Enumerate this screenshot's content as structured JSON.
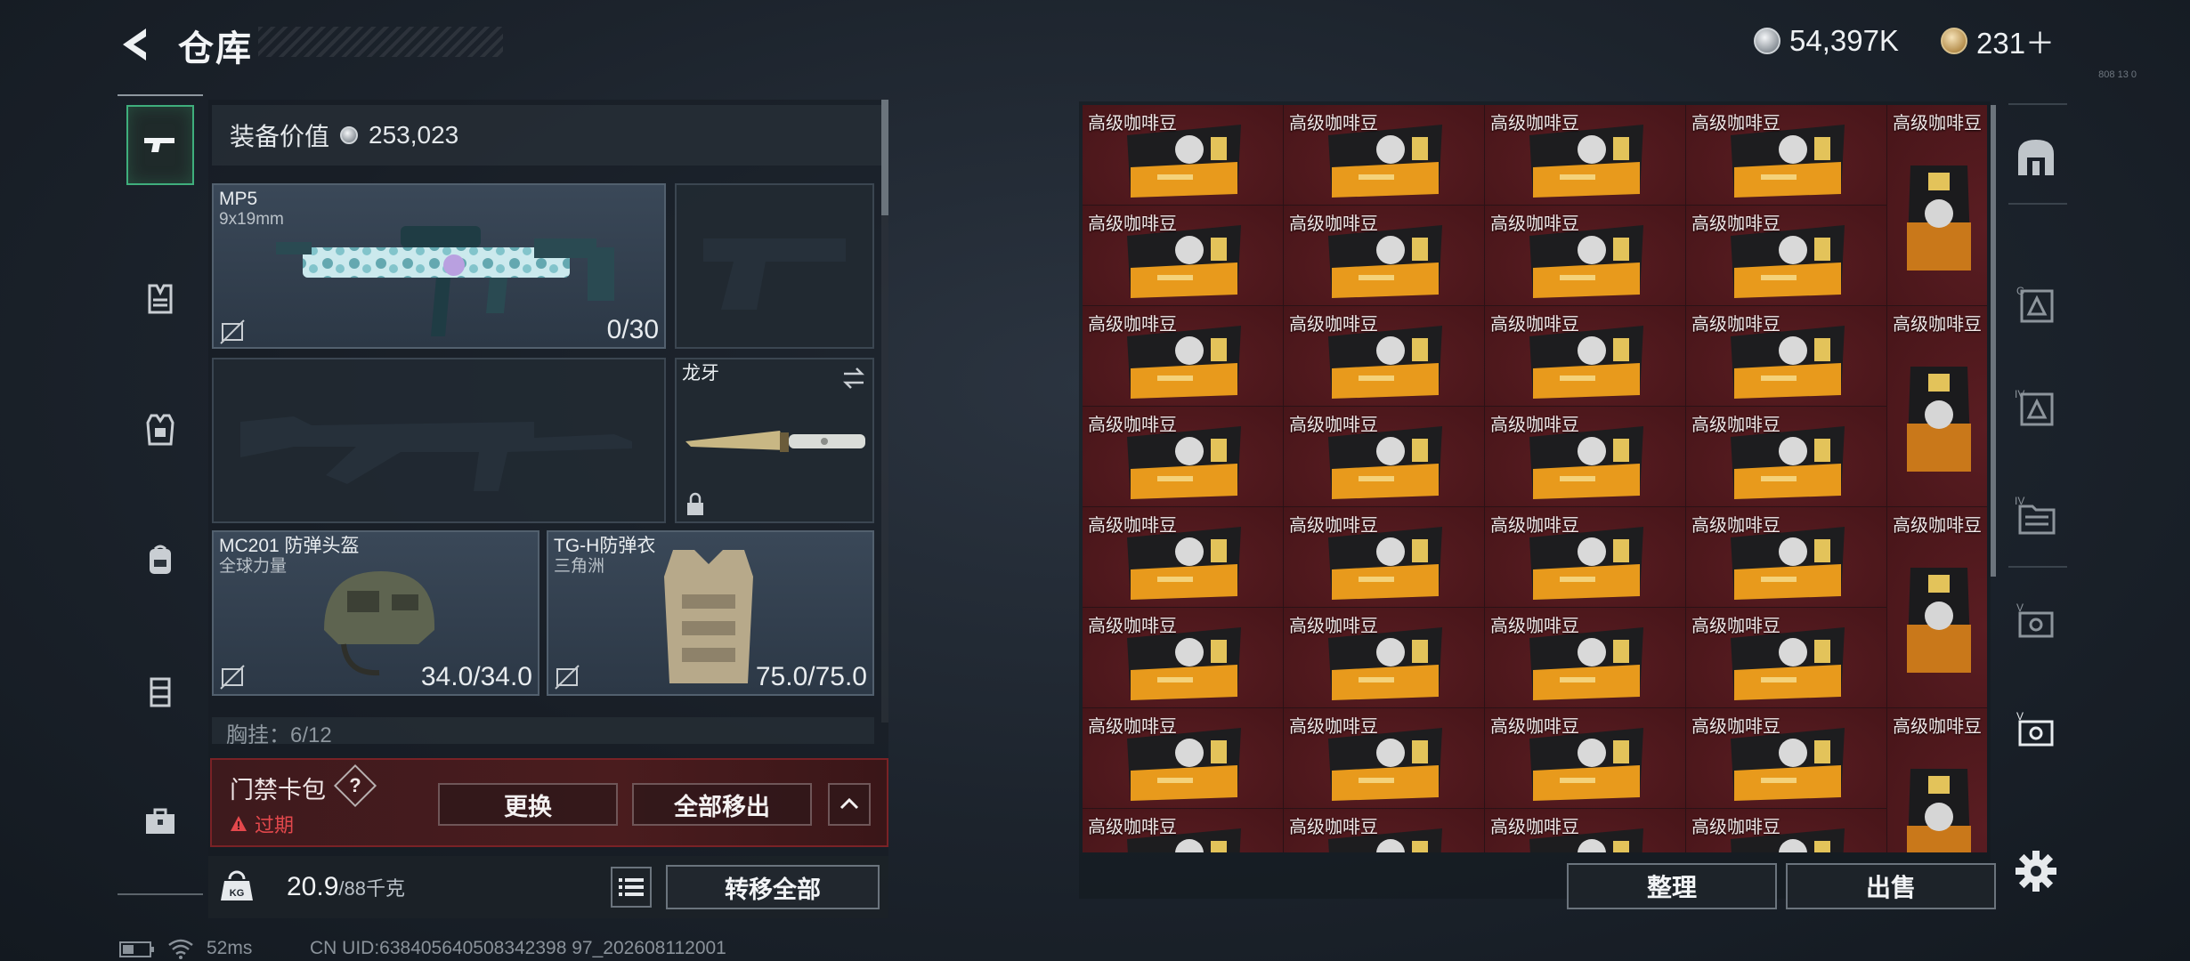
{
  "header": {
    "title": "仓库",
    "currency_silver": "54,397K",
    "currency_gold": "231＋",
    "version": "808 13 0"
  },
  "left_rail": {
    "items": [
      "pistol-icon",
      "backpack-frame-icon",
      "armor-vest-icon",
      "backpack-icon",
      "case-icon",
      "toolbox-icon"
    ]
  },
  "loadout": {
    "equip_value_label": "装备价值",
    "equip_value": "253,023",
    "primary": {
      "name": "MP5",
      "caliber": "9x19mm",
      "ammo": "0/30"
    },
    "knife": {
      "name": "龙牙"
    },
    "helmet": {
      "name": "MC201 防弹头盔",
      "brand": "全球力量",
      "durability": "34.0/34.0"
    },
    "armor": {
      "name": "TG-H防弹衣",
      "brand": "三角洲",
      "durability": "75.0/75.0"
    },
    "chest_row": "胸挂：6/12"
  },
  "card_bar": {
    "title": "门禁卡包",
    "help": "?",
    "status": "过期",
    "replace_label": "更换",
    "remove_all_label": "全部移出"
  },
  "weight": {
    "current": "20.9",
    "max": "/88千克",
    "transfer_all_label": "转移全部"
  },
  "storage": {
    "item_label": "高级咖啡豆",
    "small_rows": 8,
    "small_cols": 4,
    "tall_count": 4,
    "sort_label": "整理",
    "sell_label": "出售"
  },
  "right_rail": {
    "items": [
      "safehouse-icon",
      "storage-g-icon",
      "storage-iv-icon",
      "folder-iv-icon",
      "case-v-icon",
      "case-v-active-icon"
    ]
  },
  "status_bar": {
    "ping": "52ms",
    "uid": "CN UID:638405640508342398 97_202608112001"
  },
  "colors": {
    "accent_green": "#3fae7c",
    "alert_red": "#e3484c",
    "cell_bg": "#4f181c"
  }
}
